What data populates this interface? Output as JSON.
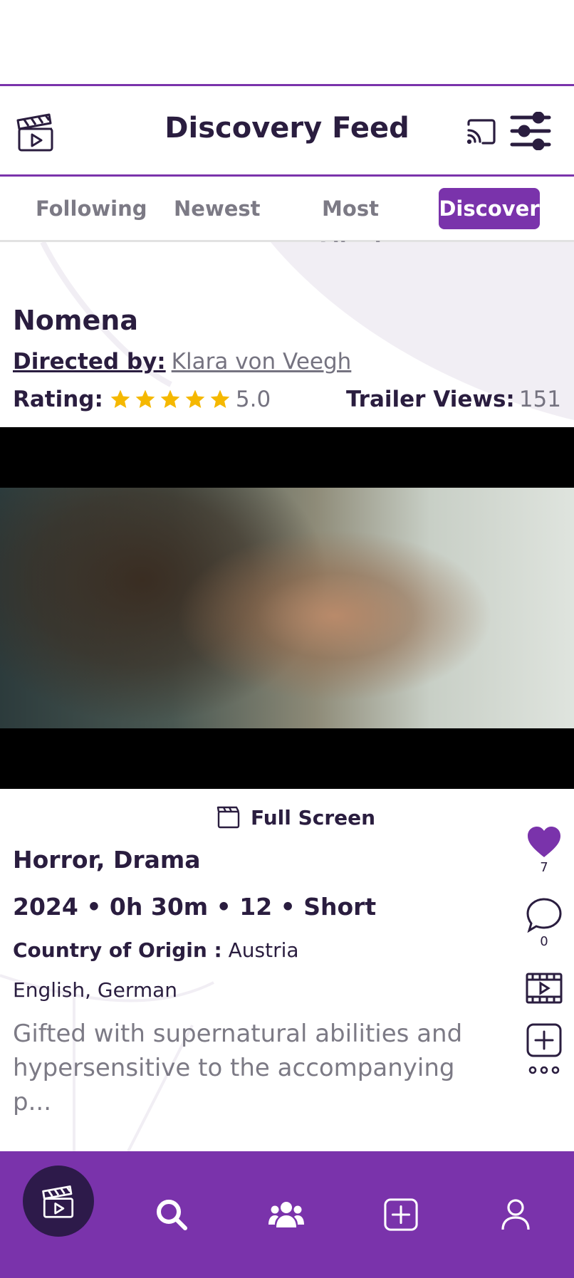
{
  "header": {
    "title": "Discovery Feed",
    "logo_icon": "clapperboard-play-icon",
    "cast_icon": "cast-icon",
    "filter_icon": "sliders-icon"
  },
  "tabs": [
    {
      "label": "Following",
      "active": false
    },
    {
      "label": "Newest",
      "active": false
    },
    {
      "label": "Most Liked",
      "active": false
    },
    {
      "label": "Discover",
      "active": true
    }
  ],
  "movie": {
    "title": "Nomena",
    "directed_by_label": "Directed by:",
    "director": "Klara von Veegh",
    "rating_label": "Rating:",
    "stars": 5,
    "rating_value": "5.0",
    "trailer_views_label": "Trailer Views:",
    "trailer_views": "151",
    "fullscreen_label": "Full Screen",
    "genres": "Horror, Drama",
    "meta": "2024 • 0h 30m • 12 • Short",
    "country_label": "Country of Origin :",
    "country": "Austria",
    "languages": "English, German",
    "synopsis": "Gifted with supernatural abilities and hypersensitive to the accompanying p..."
  },
  "actions": {
    "likes": "7",
    "comments": "0"
  },
  "colors": {
    "accent": "#7a33ab",
    "dark": "#2a1d3f",
    "star": "#f5b800",
    "muted": "#7c7a85"
  },
  "bottom_nav": [
    "clapperboard-home-icon",
    "search-icon",
    "community-icon",
    "add-icon",
    "profile-icon"
  ]
}
